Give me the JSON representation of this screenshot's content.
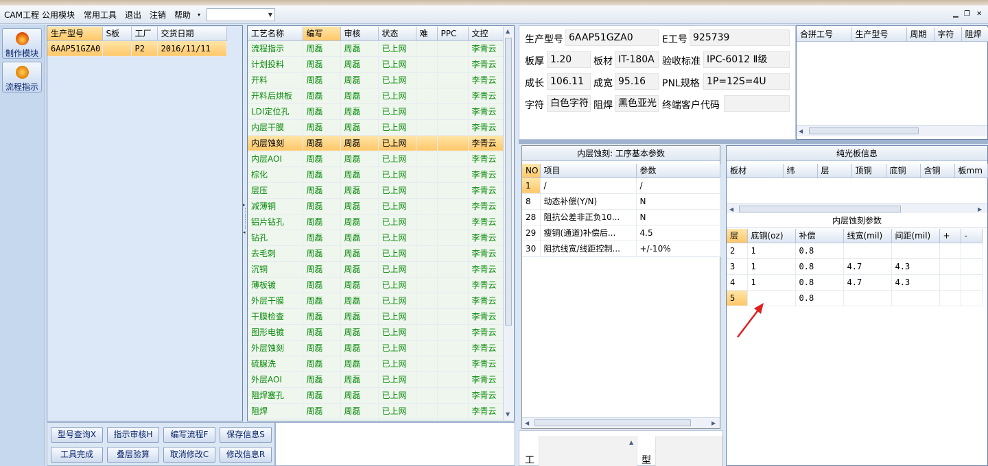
{
  "menu": {
    "items": [
      "CAM工程",
      "公用模块",
      "常用工具",
      "退出",
      "注销",
      "帮助"
    ],
    "dropdown_value": ""
  },
  "nav": {
    "buttons": [
      {
        "label": "制作模块",
        "icon": "flame-icon"
      },
      {
        "label": "流程指示",
        "icon": "pause-circle-icon"
      }
    ]
  },
  "product_list": {
    "headers": [
      "生产型号",
      "S板",
      "工厂",
      "交货日期"
    ],
    "rows": [
      [
        "6AAP51GZA0",
        "",
        "P2",
        "2016/11/11"
      ]
    ]
  },
  "process_table": {
    "headers": [
      "工艺名称",
      "编写",
      "审核",
      "状态",
      "难",
      "PPC",
      "文控"
    ],
    "selected_index": 6,
    "rows": [
      [
        "流程指示",
        "周磊",
        "周磊",
        "已上网",
        "",
        "",
        "李青云"
      ],
      [
        "计划投料",
        "周磊",
        "周磊",
        "已上网",
        "",
        "",
        "李青云"
      ],
      [
        "开料",
        "周磊",
        "周磊",
        "已上网",
        "",
        "",
        "李青云"
      ],
      [
        "开料后烘板",
        "周磊",
        "周磊",
        "已上网",
        "",
        "",
        "李青云"
      ],
      [
        "LDI定位孔",
        "周磊",
        "周磊",
        "已上网",
        "",
        "",
        "李青云"
      ],
      [
        "内层干膜",
        "周磊",
        "周磊",
        "已上网",
        "",
        "",
        "李青云"
      ],
      [
        "内层蚀刻",
        "周磊",
        "周磊",
        "已上网",
        "",
        "",
        "李青云"
      ],
      [
        "内层AOI",
        "周磊",
        "周磊",
        "已上网",
        "",
        "",
        "李青云"
      ],
      [
        "棕化",
        "周磊",
        "周磊",
        "已上网",
        "",
        "",
        "李青云"
      ],
      [
        "层压",
        "周磊",
        "周磊",
        "已上网",
        "",
        "",
        "李青云"
      ],
      [
        "减薄铜",
        "周磊",
        "周磊",
        "已上网",
        "",
        "",
        "李青云"
      ],
      [
        "铝片钻孔",
        "周磊",
        "周磊",
        "已上网",
        "",
        "",
        "李青云"
      ],
      [
        "钻孔",
        "周磊",
        "周磊",
        "已上网",
        "",
        "",
        "李青云"
      ],
      [
        "去毛刺",
        "周磊",
        "周磊",
        "已上网",
        "",
        "",
        "李青云"
      ],
      [
        "沉铜",
        "周磊",
        "周磊",
        "已上网",
        "",
        "",
        "李青云"
      ],
      [
        "薄板镀",
        "周磊",
        "周磊",
        "已上网",
        "",
        "",
        "李青云"
      ],
      [
        "外层干膜",
        "周磊",
        "周磊",
        "已上网",
        "",
        "",
        "李青云"
      ],
      [
        "干膜检查",
        "周磊",
        "周磊",
        "已上网",
        "",
        "",
        "李青云"
      ],
      [
        "图形电镀",
        "周磊",
        "周磊",
        "已上网",
        "",
        "",
        "李青云"
      ],
      [
        "外层蚀刻",
        "周磊",
        "周磊",
        "已上网",
        "",
        "",
        "李青云"
      ],
      [
        "硫脲洗",
        "周磊",
        "周磊",
        "已上网",
        "",
        "",
        "李青云"
      ],
      [
        "外层AOI",
        "周磊",
        "周磊",
        "已上网",
        "",
        "",
        "李青云"
      ],
      [
        "阻焊塞孔",
        "周磊",
        "周磊",
        "已上网",
        "",
        "",
        "李青云"
      ],
      [
        "阻焊",
        "周磊",
        "周磊",
        "已上网",
        "",
        "",
        "李青云"
      ]
    ]
  },
  "buttons": {
    "row1": [
      "型号查询X",
      "指示审核H",
      "编写流程F",
      "保存信息S"
    ],
    "row2": [
      "工具完成",
      "叠层验算",
      "取消修改C",
      "修改信息R"
    ]
  },
  "info": {
    "production_model_label": "生产型号",
    "production_model": "6AAP51GZA0",
    "e_work_no_label": "E工号",
    "e_work_no": "925739",
    "thickness_label": "板厚",
    "thickness": "1.20",
    "material_label": "板材",
    "material": "IT-180A",
    "standard_label": "验收标准",
    "standard": "IPC-6012 Ⅱ级",
    "length_label": "成长",
    "length": "106.11",
    "width_label": "成宽",
    "width": "95.16",
    "pnl_label": "PNL规格",
    "pnl": "1P=12S=4U",
    "legend_label": "字符",
    "legend": "白色字符",
    "solder_label": "阻焊",
    "solder": "黑色亚光",
    "customer_code_label": "终端客户代码",
    "customer_code": ""
  },
  "combine_table": {
    "headers": [
      "合拼工号",
      "生产型号",
      "周期",
      "字符",
      "阻焊"
    ]
  },
  "params": {
    "title": "内层蚀刻: 工序基本参数",
    "headers": [
      "NO",
      "项目",
      "参数"
    ],
    "rows": [
      [
        "1",
        "/",
        "/"
      ],
      [
        "8",
        "动态补偿(Y/N)",
        "N"
      ],
      [
        "28",
        "阻抗公差非正负10...",
        "N"
      ],
      [
        "29",
        "瘦铜(通道)补偿后...",
        "4.5"
      ],
      [
        "30",
        "阻抗线宽/线距控制...",
        "+/-10%"
      ]
    ]
  },
  "core_info": {
    "title": "纯光板信息",
    "headers": [
      "板材",
      "纬",
      "层",
      "顶铜",
      "底铜",
      "含铜",
      "板mm"
    ]
  },
  "etch_params": {
    "title": "内层蚀刻参数",
    "headers": [
      "层",
      "底铜(oz)",
      "补偿",
      "线宽(mil)",
      "间距(mil)",
      "+",
      "-"
    ],
    "rows": [
      [
        "2",
        "1",
        "0.8",
        "",
        "",
        "",
        ""
      ],
      [
        "3",
        "1",
        "0.8",
        "4.7",
        "4.3",
        "",
        ""
      ],
      [
        "4",
        "1",
        "0.8",
        "4.7",
        "4.3",
        "",
        ""
      ],
      [
        "5",
        "",
        "0.8",
        "",
        "",
        "",
        ""
      ]
    ]
  },
  "bottom": {
    "left_label": "工",
    "right_label": "型"
  },
  "colors": {
    "accent_selected": "#ffc76a",
    "process_text": "#0a8a0a",
    "annotation_arrow": "#e02020"
  }
}
